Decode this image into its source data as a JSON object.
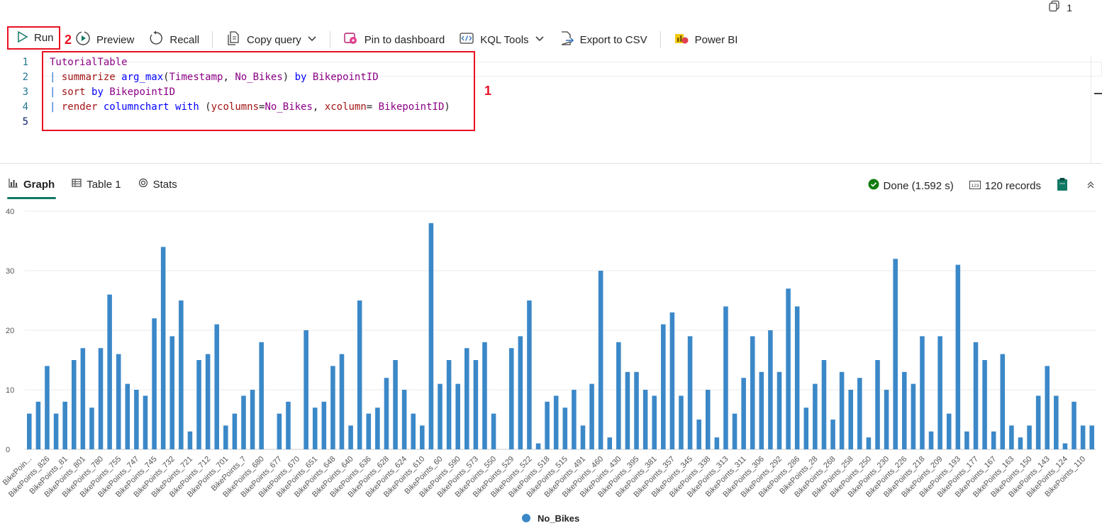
{
  "topbar": {
    "copies_count": "1"
  },
  "toolbar": {
    "run_label": "Run",
    "preview_label": "Preview",
    "recall_label": "Recall",
    "copy_query_label": "Copy query",
    "pin_label": "Pin to dashboard",
    "kql_tools_label": "KQL Tools",
    "export_label": "Export to CSV",
    "powerbi_label": "Power BI"
  },
  "annotations": {
    "query_marker": "1",
    "run_marker": "2"
  },
  "editor": {
    "line_numbers": [
      "1",
      "2",
      "3",
      "4",
      "5"
    ],
    "lines": [
      [
        {
          "t": "TutorialTable",
          "c": "k-col"
        }
      ],
      [
        {
          "t": "| ",
          "c": "k-pipe"
        },
        {
          "t": "summarize",
          "c": "k-op"
        },
        {
          "t": " ",
          "c": "k-txt"
        },
        {
          "t": "arg_max",
          "c": "k-fn"
        },
        {
          "t": "(",
          "c": "k-txt"
        },
        {
          "t": "Timestamp",
          "c": "k-col"
        },
        {
          "t": ", ",
          "c": "k-txt"
        },
        {
          "t": "No_Bikes",
          "c": "k-col"
        },
        {
          "t": ") ",
          "c": "k-txt"
        },
        {
          "t": "by",
          "c": "k-fn"
        },
        {
          "t": " ",
          "c": "k-txt"
        },
        {
          "t": "BikepointID",
          "c": "k-col"
        }
      ],
      [
        {
          "t": "| ",
          "c": "k-pipe"
        },
        {
          "t": "sort",
          "c": "k-op"
        },
        {
          "t": " ",
          "c": "k-txt"
        },
        {
          "t": "by",
          "c": "k-fn"
        },
        {
          "t": " ",
          "c": "k-txt"
        },
        {
          "t": "BikepointID",
          "c": "k-col"
        }
      ],
      [
        {
          "t": "| ",
          "c": "k-pipe"
        },
        {
          "t": "render",
          "c": "k-op"
        },
        {
          "t": " ",
          "c": "k-txt"
        },
        {
          "t": "columnchart",
          "c": "k-fn"
        },
        {
          "t": " ",
          "c": "k-txt"
        },
        {
          "t": "with",
          "c": "k-fn"
        },
        {
          "t": " (",
          "c": "k-txt"
        },
        {
          "t": "ycolumns",
          "c": "k-op"
        },
        {
          "t": "=",
          "c": "k-txt"
        },
        {
          "t": "No_Bikes",
          "c": "k-col"
        },
        {
          "t": ", ",
          "c": "k-txt"
        },
        {
          "t": "xcolumn",
          "c": "k-op"
        },
        {
          "t": "= ",
          "c": "k-txt"
        },
        {
          "t": "BikepointID",
          "c": "k-col"
        },
        {
          "t": ")",
          "c": "k-txt"
        }
      ],
      []
    ]
  },
  "results": {
    "tabs": [
      "Graph",
      "Table 1",
      "Stats"
    ],
    "status": "Done (1.592 s)",
    "records": "120 records"
  },
  "colors": {
    "accent": "#117865",
    "bar": "#3b88c8",
    "highlight": "#e81123"
  },
  "chart_data": {
    "type": "bar",
    "ylim": [
      0,
      40
    ],
    "yticks": [
      0,
      10,
      20,
      30,
      40
    ],
    "grid": true,
    "legend": "bottom-center",
    "series": [
      {
        "name": "No_Bikes"
      }
    ],
    "values": [
      6,
      8,
      14,
      6,
      8,
      15,
      17,
      7,
      17,
      26,
      16,
      11,
      10,
      9,
      22,
      34,
      19,
      25,
      3,
      15,
      16,
      21,
      4,
      6,
      9,
      10,
      18,
      0,
      6,
      8,
      0,
      20,
      7,
      8,
      14,
      16,
      4,
      25,
      6,
      7,
      12,
      15,
      10,
      6,
      4,
      38,
      11,
      15,
      11,
      17,
      15,
      18,
      6,
      0,
      17,
      19,
      25,
      1,
      8,
      9,
      7,
      10,
      4,
      11,
      30,
      2,
      18,
      13,
      13,
      10,
      9,
      21,
      23,
      9,
      19,
      5,
      10,
      2,
      24,
      6,
      12,
      19,
      13,
      20,
      13,
      27,
      24,
      7,
      11,
      15,
      5,
      13,
      10,
      12,
      2,
      15,
      10,
      32,
      13,
      11,
      19,
      3,
      19,
      6,
      31,
      3,
      18,
      15,
      3,
      16,
      4,
      2,
      4,
      9,
      14,
      9,
      1,
      8,
      4,
      4
    ],
    "tick_labels": [
      "BikePoin...",
      "BikePoints_826",
      "BikePoints_81",
      "BikePoints_801",
      "BikePoints_780",
      "BikePoints_755",
      "BikePoints_747",
      "BikePoints_745",
      "BikePoints_732",
      "BikePoints_721",
      "BikePoints_712",
      "BikePoints_701",
      "BikePoints_7",
      "BikePoints_680",
      "BikePoints_677",
      "BikePoints_670",
      "BikePoints_651",
      "BikePoints_648",
      "BikePoints_640",
      "BikePoints_636",
      "BikePoints_628",
      "BikePoints_624",
      "BikePoints_610",
      "BikePoints_60",
      "BikePoints_590",
      "BikePoints_573",
      "BikePoints_550",
      "BikePoints_529",
      "BikePoints_522",
      "BikePoints_518",
      "BikePoints_515",
      "BikePoints_491",
      "BikePoints_460",
      "BikePoints_430",
      "BikePoints_395",
      "BikePoints_381",
      "BikePoints_357",
      "BikePoints_345",
      "BikePoints_338",
      "BikePoints_313",
      "BikePoints_311",
      "BikePoints_306",
      "BikePoints_292",
      "BikePoints_286",
      "BikePoints_28",
      "BikePoints_268",
      "BikePoints_258",
      "BikePoints_250",
      "BikePoints_230",
      "BikePoints_226",
      "BikePoints_218",
      "BikePoints_209",
      "BikePoints_193",
      "BikePoints_177",
      "BikePoints_167",
      "BikePoints_163",
      "BikePoints_150",
      "BikePoints_143",
      "BikePoints_124",
      "BikePoints_110"
    ]
  }
}
